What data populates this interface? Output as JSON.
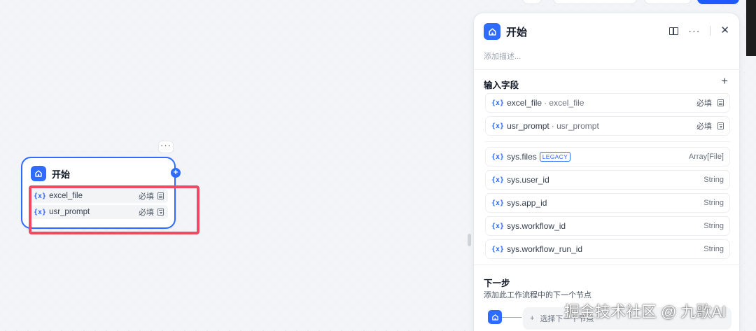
{
  "node": {
    "title": "开始",
    "more": "···",
    "plus": "+",
    "vars": [
      {
        "icon": "{x}",
        "name": "excel_file",
        "required": "必填",
        "type_icon": "document-icon"
      },
      {
        "icon": "{x}",
        "name": "usr_prompt",
        "required": "必填",
        "type_icon": "select-icon"
      }
    ]
  },
  "panel": {
    "title": "开始",
    "description_placeholder": "添加描述...",
    "input_section_title": "输入字段",
    "add_label": "+",
    "user_fields": [
      {
        "icon": "{x}",
        "name": "excel_file",
        "alias": "· excel_file",
        "required": "必填",
        "type_icon": "document-icon"
      },
      {
        "icon": "{x}",
        "name": "usr_prompt",
        "alias": "· usr_prompt",
        "required": "必填",
        "type_icon": "select-icon"
      }
    ],
    "system_fields": [
      {
        "icon": "{x}",
        "name": "sys.files",
        "badge": "LEGACY",
        "type": "Array[File]"
      },
      {
        "icon": "{x}",
        "name": "sys.user_id",
        "badge": "",
        "type": "String"
      },
      {
        "icon": "{x}",
        "name": "sys.app_id",
        "badge": "",
        "type": "String"
      },
      {
        "icon": "{x}",
        "name": "sys.workflow_id",
        "badge": "",
        "type": "String"
      },
      {
        "icon": "{x}",
        "name": "sys.workflow_run_id",
        "badge": "",
        "type": "String"
      }
    ],
    "next_title": "下一步",
    "next_subtitle": "添加此工作流程中的下一个节点",
    "next_select_icon": "+",
    "next_select_label": "选择下一个节点"
  },
  "watermark": "掘金技术社区 @ 九歌AI",
  "colors": {
    "accent": "#2f6bff",
    "highlight": "#ef4a61"
  }
}
